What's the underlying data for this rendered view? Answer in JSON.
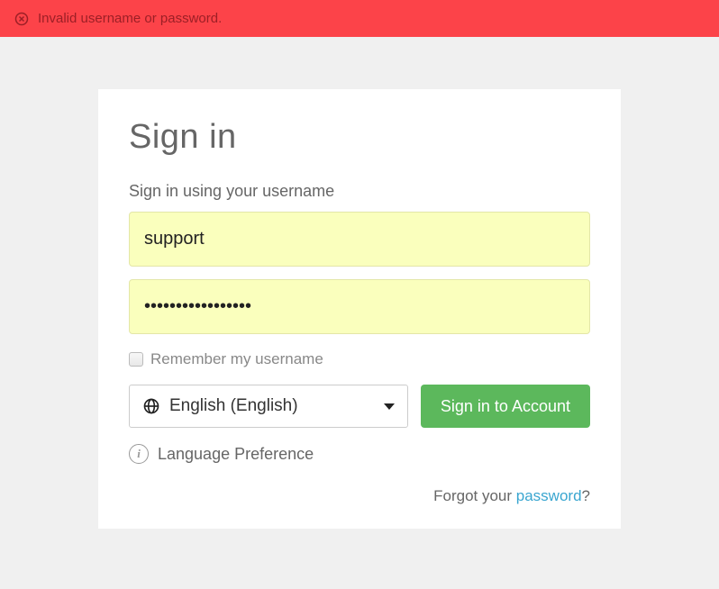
{
  "error": {
    "message": "Invalid username or password."
  },
  "card": {
    "title": "Sign in",
    "subtitle": "Sign in using your username",
    "username_value": "support",
    "password_value": "•••••••••••••••••",
    "remember_label": "Remember my username",
    "language": {
      "selected": "English (English)",
      "pref_label": "Language Preference"
    },
    "signin_button": "Sign in to Account",
    "forgot": {
      "prefix": "Forgot your ",
      "link": "password",
      "suffix": "?"
    }
  },
  "colors": {
    "error_bg": "#fc4349",
    "accent_green": "#5cb85c",
    "link": "#3aa6d0",
    "autofill": "#faffbd"
  }
}
